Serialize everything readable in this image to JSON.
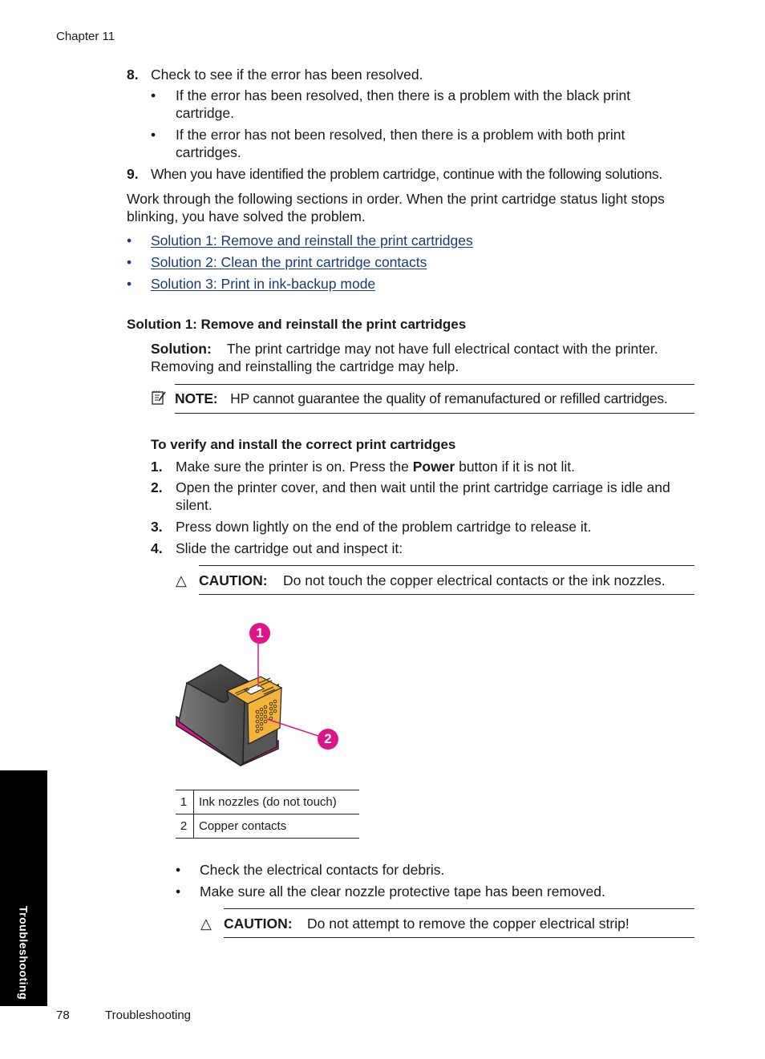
{
  "header": {
    "chapter": "Chapter 11"
  },
  "steps_top": [
    {
      "num": "8.",
      "text": "Check to see if the error has been resolved."
    },
    {
      "num": "9.",
      "text": "When you have identified the problem cartridge, continue with the following solutions."
    }
  ],
  "step8_bullets": [
    {
      "line1": "If the error has been resolved, then there is a problem with the black print",
      "line2": "cartridge."
    },
    {
      "line1": "If the error has not been resolved, then there is a problem with both print",
      "line2": "cartridges."
    }
  ],
  "intro": {
    "line1": "Work through the following sections in order. When the print cartridge status light stops",
    "line2": "blinking, you have solved the problem."
  },
  "solution_links": [
    {
      "label": "Solution 1: Remove and reinstall the print cartridges"
    },
    {
      "label": "Solution 2: Clean the print cartridge contacts"
    },
    {
      "label": "Solution 3: Print in ink-backup mode"
    }
  ],
  "solution1": {
    "heading": "Solution 1: Remove and reinstall the print cartridges",
    "solution_label": "Solution:",
    "solution_line1": "The print cartridge may not have full electrical contact with the printer.",
    "solution_line2": "Removing and reinstalling the cartridge may help.",
    "note_label": "NOTE:",
    "note_text": "HP cannot guarantee the quality of remanufactured or refilled cartridges."
  },
  "procedure": {
    "heading": "To verify and install the correct print cartridges",
    "steps": [
      {
        "num": "1.",
        "pre": "Make sure the printer is on. Press the ",
        "bold": "Power",
        "post": " button if it is not lit."
      },
      {
        "num": "2.",
        "line1": "Open the printer cover, and then wait until the print cartridge carriage is idle and",
        "line2": "silent."
      },
      {
        "num": "3.",
        "text": "Press down lightly on the end of the problem cartridge to release it."
      },
      {
        "num": "4.",
        "text": "Slide the cartridge out and inspect it:"
      }
    ],
    "caution1_label": "CAUTION:",
    "caution1_text": "Do not touch the copper electrical contacts or the ink nozzles."
  },
  "figure": {
    "callouts": [
      "1",
      "2"
    ],
    "legend": [
      {
        "num": "1",
        "label": "Ink nozzles (do not touch)"
      },
      {
        "num": "2",
        "label": "Copper contacts"
      }
    ],
    "colors": {
      "callout": "#e0148a",
      "cartridge_body": "#5a5a5a",
      "contacts": "#f3b43c",
      "base_stripe": "#e0148a"
    }
  },
  "after_bullets": [
    {
      "text": "Check the electrical contacts for debris."
    },
    {
      "text": "Make sure all the clear nozzle protective tape has been removed."
    }
  ],
  "caution2": {
    "label": "CAUTION:",
    "text": "Do not attempt to remove the copper electrical strip!"
  },
  "side_tab": {
    "label": "Troubleshooting"
  },
  "footer": {
    "page_number": "78",
    "section": "Troubleshooting"
  },
  "glyphs": {
    "bullet": "•",
    "caution_icon": "△"
  }
}
